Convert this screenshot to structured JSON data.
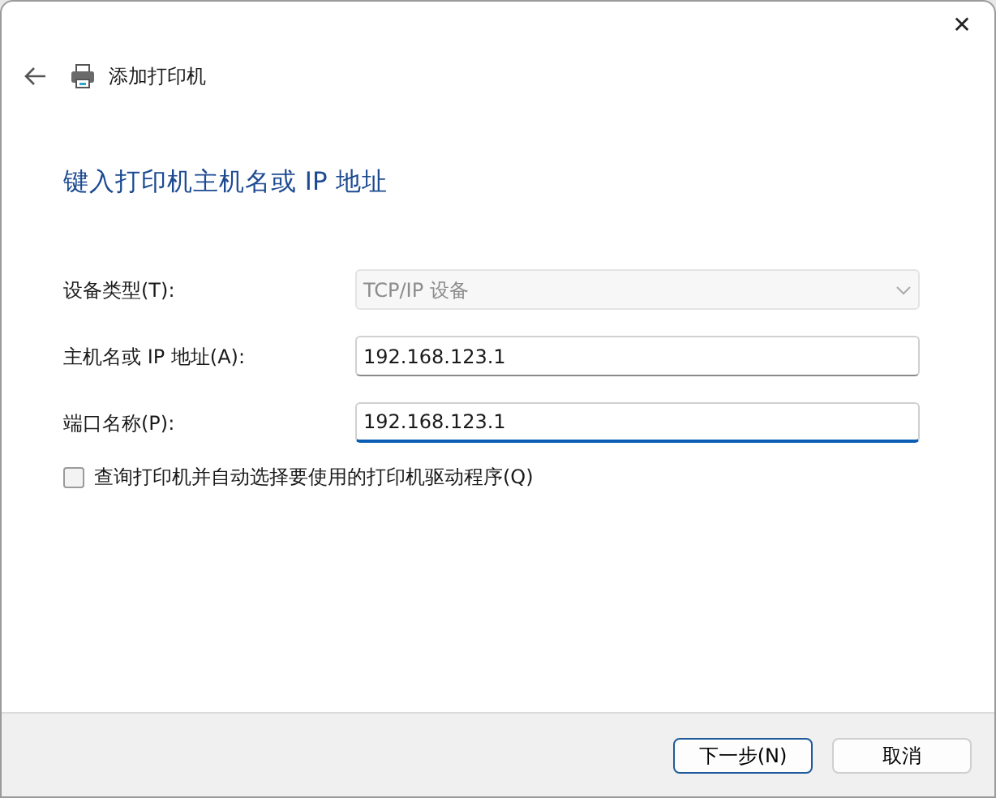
{
  "window": {
    "title": "添加打印机",
    "close": "✕"
  },
  "heading": "键入打印机主机名或 IP 地址",
  "fields": [
    {
      "kind": "select",
      "label": "设备类型(T):",
      "value": "TCP/IP 设备",
      "disabled": true,
      "focused": false
    },
    {
      "kind": "text",
      "label": "主机名或 IP 地址(A):",
      "value": "192.168.123.1",
      "disabled": false,
      "focused": false
    },
    {
      "kind": "text",
      "label": "端口名称(P):",
      "value": "192.168.123.1",
      "disabled": false,
      "focused": true
    }
  ],
  "checkbox": {
    "label": "查询打印机并自动选择要使用的打印机驱动程序(Q)",
    "checked": false
  },
  "buttons": [
    {
      "label": "下一步(N)",
      "default": true
    },
    {
      "label": "取消",
      "default": false
    }
  ]
}
